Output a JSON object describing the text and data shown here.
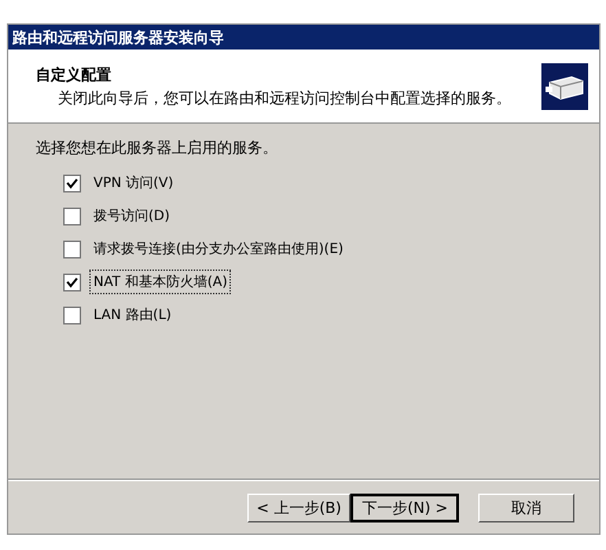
{
  "window": {
    "title": "路由和远程访问服务器安装向导"
  },
  "header": {
    "title": "自定义配置",
    "subtitle": "关闭此向导后，您可以在路由和远程访问控制台中配置选择的服务。"
  },
  "prompt": "选择您想在此服务器上启用的服务。",
  "options": [
    {
      "label": "VPN 访问(V)",
      "checked": true,
      "focused": false
    },
    {
      "label": "拨号访问(D)",
      "checked": false,
      "focused": false
    },
    {
      "label": "请求拨号连接(由分支办公室路由使用)(E)",
      "checked": false,
      "focused": false
    },
    {
      "label": "NAT 和基本防火墙(A)",
      "checked": true,
      "focused": true
    },
    {
      "label": "LAN 路由(L)",
      "checked": false,
      "focused": false
    }
  ],
  "buttons": [
    {
      "label": "< 上一步(B)",
      "default": false
    },
    {
      "label": "下一步(N) >",
      "default": true
    },
    {
      "label": "取消",
      "default": false
    }
  ]
}
